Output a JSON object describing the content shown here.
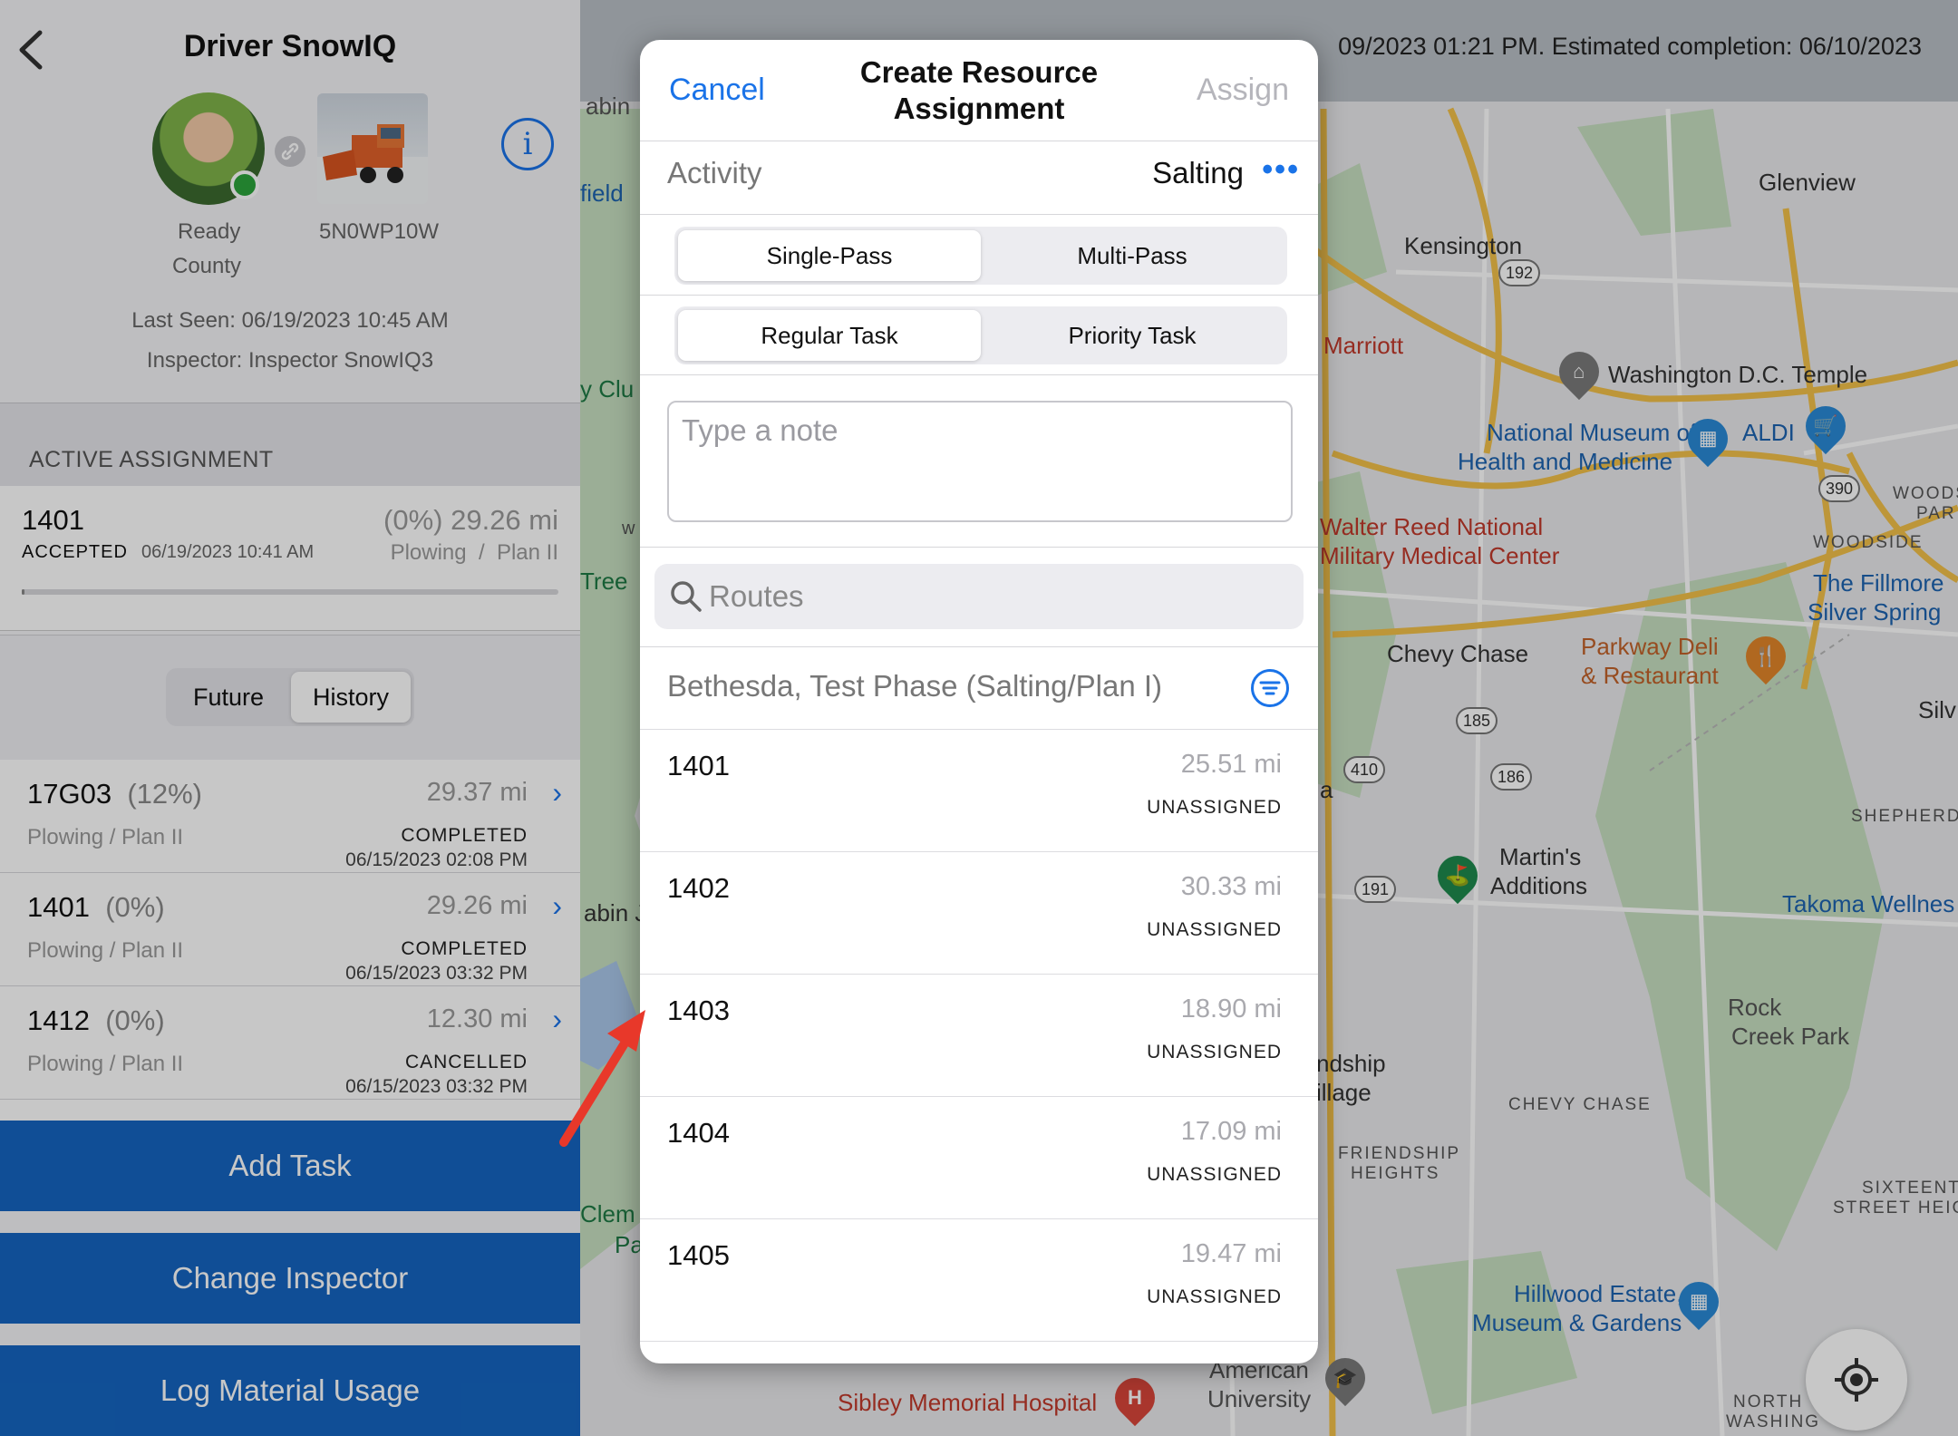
{
  "left_panel": {
    "title": "Driver SnowIQ",
    "driver_status": "Ready",
    "driver_org": "County",
    "vehicle_id": "5N0WP10W",
    "last_seen": "Last Seen: 06/19/2023 10:45 AM",
    "inspector": "Inspector: Inspector SnowIQ3",
    "active_assignment_header": "ACTIVE ASSIGNMENT",
    "active_assignment": {
      "id": "1401",
      "status": "ACCEPTED",
      "date": "06/19/2023 10:41 AM",
      "progress_text": "(0%) 29.26 mi",
      "subtitle": "Plowing  /  Plan II",
      "progress": 0.005
    },
    "segment": {
      "future": "Future",
      "history": "History",
      "selected": "History"
    },
    "history": [
      {
        "id": "17G03",
        "pct": "(12%)",
        "miles": "29.37 mi",
        "sub": "Plowing / Plan II",
        "status": "COMPLETED",
        "date": "06/15/2023 02:08 PM"
      },
      {
        "id": "1401",
        "pct": "(0%)",
        "miles": "29.26 mi",
        "sub": "Plowing / Plan II",
        "status": "COMPLETED",
        "date": "06/15/2023 03:32 PM"
      },
      {
        "id": "1412",
        "pct": "(0%)",
        "miles": "12.30 mi",
        "sub": "Plowing / Plan II",
        "status": "CANCELLED",
        "date": "06/15/2023 03:32 PM"
      }
    ],
    "buttons": {
      "add_task": "Add Task",
      "change_inspector": "Change Inspector",
      "log_material": "Log Material Usage"
    }
  },
  "map": {
    "banner_text": "09/2023 01:21 PM. Estimated completion: 06/10/2023",
    "labels": {
      "glenview": "Glenview",
      "kensington": "Kensington",
      "marriott": "Marriott",
      "temple": "Washington D.C. Temple",
      "museum_1": "National Museum of",
      "museum_2": "Health and Medicine",
      "aldi": "ALDI",
      "woods": "WOODS",
      "park_frag": "PAR",
      "woodside": "WOODSIDE",
      "walter_1": "Walter Reed National",
      "walter_2": "Military Medical Center",
      "fillmore_1": "The Fillmore",
      "fillmore_2": "Silver Spring",
      "chevy_chase": "Chevy Chase",
      "parkway_1": "Parkway Deli",
      "parkway_2": "& Restaurant",
      "silv": "Silv",
      "shepherd": "SHEPHERD",
      "martins_1": "Martin's",
      "martins_2": "Additions",
      "takoma": "Takoma Wellnes",
      "rock_1": "Rock",
      "rock_2": "Creek Park",
      "ndship_1": "ndship",
      "ndship_2": "illage",
      "chevy_chase_caps": "CHEVY CHASE",
      "friendship_1": "FRIENDSHIP",
      "friendship_2": "HEIGHTS",
      "sixteenth_1": "SIXTEENTH",
      "sixteenth_2": "STREET HEIGH",
      "hillwood_1": "Hillwood Estate,",
      "hillwood_2": "Museum & Gardens",
      "american_1": "American",
      "american_2": "University",
      "sibley": "Sibley Memorial Hospital",
      "north_1": "NORTH",
      "north_2": "WASHING",
      "frag_abin": "abin",
      "frag_field": "field",
      "frag_yclu": "y Clu",
      "frag_w": "w",
      "frag_tree": "Tree",
      "frag_abin2": "abin J",
      "frag_clem": "Clem",
      "frag_pa": "Pa",
      "frag_a": "a"
    },
    "shields": {
      "s192": "192",
      "s390": "390",
      "s185": "185",
      "s186": "186",
      "s410": "410",
      "s191": "191"
    },
    "colors": {
      "road": "#f2c04a",
      "park": "#c7dfc0",
      "water": "#a9c7ea"
    }
  },
  "modal": {
    "cancel": "Cancel",
    "title": "Create Resource Assignment",
    "assign": "Assign",
    "activity_label": "Activity",
    "activity_value": "Salting",
    "pass_options": [
      "Single-Pass",
      "Multi-Pass"
    ],
    "pass_selected": "Single-Pass",
    "task_options": [
      "Regular Task",
      "Priority Task"
    ],
    "task_selected": "Regular Task",
    "note_placeholder": "Type a note",
    "routes_placeholder": "Routes",
    "group_title": "Bethesda, Test Phase (Salting/Plan I)",
    "routes": [
      {
        "id": "1401",
        "miles": "25.51 mi",
        "status": "UNASSIGNED"
      },
      {
        "id": "1402",
        "miles": "30.33 mi",
        "status": "UNASSIGNED"
      },
      {
        "id": "1403",
        "miles": "18.90 mi",
        "status": "UNASSIGNED"
      },
      {
        "id": "1404",
        "miles": "17.09 mi",
        "status": "UNASSIGNED"
      },
      {
        "id": "1405",
        "miles": "19.47 mi",
        "status": "UNASSIGNED"
      }
    ],
    "accent": "#1a73e8"
  },
  "annotation": {
    "arrow_color": "#e8382a"
  }
}
